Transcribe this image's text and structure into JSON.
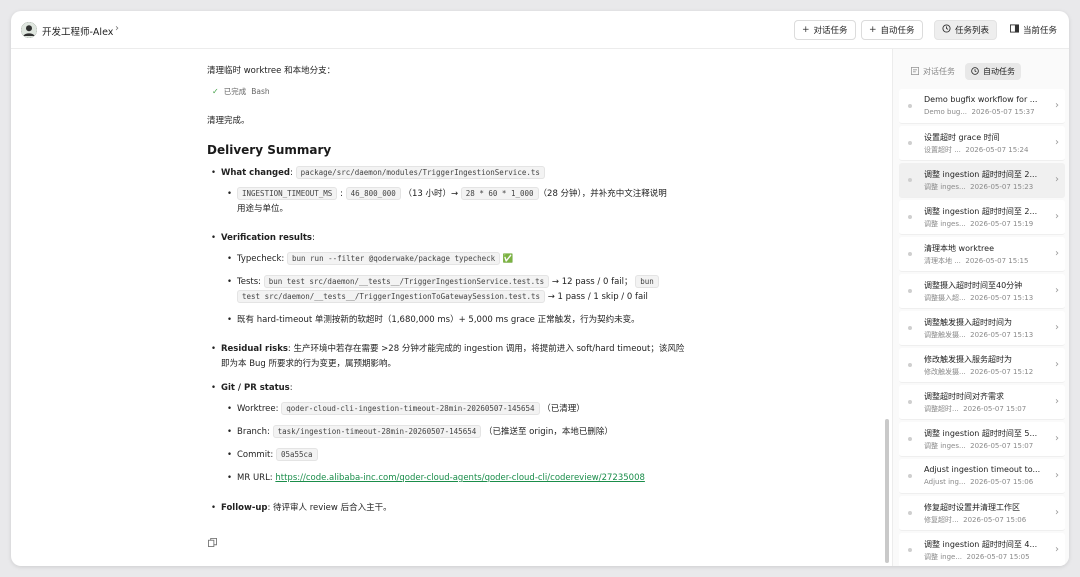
{
  "header": {
    "user_name": "开发工程师-Alex",
    "buttons": {
      "chat_task": "对话任务",
      "auto_task": "自动任务",
      "task_list": "任务列表",
      "current_task": "当前任务"
    }
  },
  "main": {
    "cleanup_text": "清理临时 worktree 和本地分支：",
    "status_done": "已完成",
    "status_tool": "Bash",
    "cleanup_done": "清理完成。",
    "summary_title": "Delivery Summary",
    "what_changed": {
      "label": "What changed",
      "file": "package/src/daemon/modules/TriggerIngestionService.ts",
      "sub_const": "INGESTION_TIMEOUT_MS",
      "sub_old": "46_800_000",
      "sub_old_note": "（13 小时）→",
      "sub_new": "28 * 60 * 1_000",
      "sub_new_note": "（28 分钟），并补充中文注释说明",
      "sub_line2": "用途与单位。"
    },
    "verification": {
      "label": "Verification results",
      "typecheck_label": "Typecheck:",
      "typecheck_cmd": "bun run --filter @qoderwake/package typecheck",
      "typecheck_ok": "✅",
      "tests_label": "Tests:",
      "tests_cmd1": "bun test src/daemon/__tests__/TriggerIngestionService.test.ts",
      "tests_res1": "→ 12 pass / 0 fail；",
      "tests_cmd2a": "bun",
      "tests_cmd2b": "test src/daemon/__tests__/TriggerIngestionToGatewaySession.test.ts",
      "tests_res2": "→ 1 pass / 1 skip / 0 fail",
      "hard_timeout": "既有 hard-timeout 单测按新的软超时（1,680,000 ms）+ 5,000 ms grace 正常触发，行为契约未变。"
    },
    "residual": {
      "label": "Residual risks",
      "text1": ": 生产环境中若存在需要 >28 分钟才能完成的 ingestion 调用，将提前进入 soft/hard timeout；该风险",
      "text2": "即为本 Bug 所要求的行为变更，属预期影响。"
    },
    "git": {
      "label": "Git / PR status",
      "worktree_label": "Worktree:",
      "worktree": "qoder-cloud-cli-ingestion-timeout-28min-20260507-145654",
      "worktree_note": "（已清理）",
      "branch_label": "Branch:",
      "branch": "task/ingestion-timeout-28min-20260507-145654",
      "branch_note": "（已推送至 origin，本地已删除）",
      "commit_label": "Commit:",
      "commit": "05a55ca",
      "mr_label": "MR URL:",
      "mr_url": "https://code.alibaba-inc.com/qoder-cloud-agents/qoder-cloud-cli/codereview/27235008"
    },
    "follow_up": {
      "label": "Follow-up",
      "text": ": 待评审人 review 后合入主干。"
    }
  },
  "sidebar": {
    "tabs": {
      "chat": "对话任务",
      "auto": "自动任务"
    },
    "tasks": [
      {
        "title": "Demo bugfix workflow for ...",
        "sub": "Demo bug...",
        "time": "2026-05-07 15:37"
      },
      {
        "title": "设置超时 grace 时间",
        "sub": "设置超时 ...",
        "time": "2026-05-07 15:24"
      },
      {
        "title": "调整 ingestion 超时时间至 2...",
        "sub": "调整 inges...",
        "time": "2026-05-07 15:23"
      },
      {
        "title": "调整 ingestion 超时时间至 2...",
        "sub": "调整 inges...",
        "time": "2026-05-07 15:19"
      },
      {
        "title": "清理本地 worktree",
        "sub": "清理本地 ...",
        "time": "2026-05-07 15:15"
      },
      {
        "title": "调整摄入超时时间至40分钟",
        "sub": "调整摄入超...",
        "time": "2026-05-07 15:13"
      },
      {
        "title": "调整触发摄入超时时间为",
        "sub": "调整触发摄...",
        "time": "2026-05-07 15:13"
      },
      {
        "title": "修改触发摄入服务超时为",
        "sub": "修改触发摄...",
        "time": "2026-05-07 15:12"
      },
      {
        "title": "调整超时时间对齐需求",
        "sub": "调整超时...",
        "time": "2026-05-07 15:07"
      },
      {
        "title": "调整 ingestion 超时时间至 5...",
        "sub": "调整 inges...",
        "time": "2026-05-07 15:07"
      },
      {
        "title": "Adjust ingestion timeout to...",
        "sub": "Adjust ing...",
        "time": "2026-05-07 15:06"
      },
      {
        "title": "修复超时设置并清理工作区",
        "sub": "修复超时...",
        "time": "2026-05-07 15:06"
      },
      {
        "title": "调整 ingestion 超时时间至 4...",
        "sub": "调整 inge...",
        "time": "2026-05-07 15:05"
      }
    ]
  }
}
